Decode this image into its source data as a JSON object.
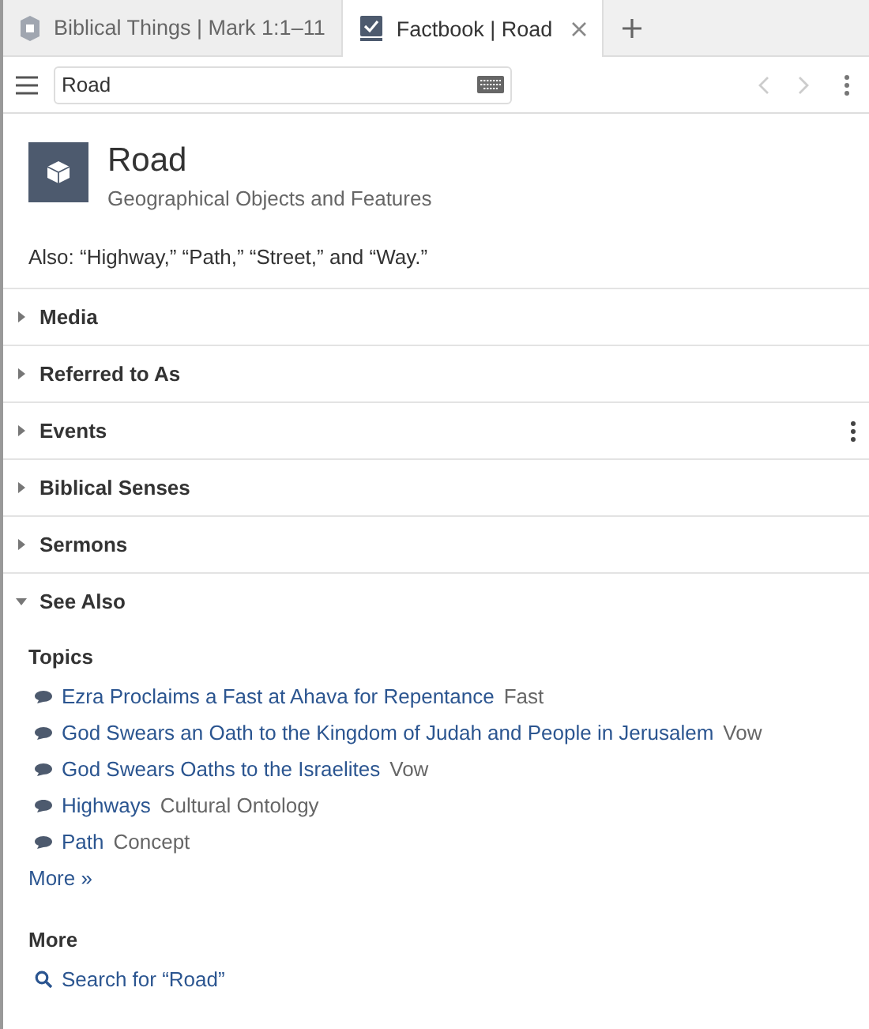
{
  "tabs": [
    {
      "label": "Biblical Things | Mark 1:1–11",
      "selected": false,
      "kind": "shield"
    },
    {
      "label": "Factbook | Road",
      "selected": true,
      "kind": "check"
    }
  ],
  "toolbar": {
    "search_value": "Road"
  },
  "header": {
    "title": "Road",
    "subtitle": "Geographical Objects and Features"
  },
  "also": "Also: “Highway,” “Path,” “Street,” and “Way.”",
  "sections": [
    {
      "label": "Media",
      "expanded": false,
      "hovered": false
    },
    {
      "label": "Referred to As",
      "expanded": false,
      "hovered": false
    },
    {
      "label": "Events",
      "expanded": false,
      "hovered": true
    },
    {
      "label": "Biblical Senses",
      "expanded": false,
      "hovered": false
    },
    {
      "label": "Sermons",
      "expanded": false,
      "hovered": false
    },
    {
      "label": "See Also",
      "expanded": true,
      "hovered": false
    }
  ],
  "see_also": {
    "topics_heading": "Topics",
    "topics": [
      {
        "title": "Ezra Proclaims a Fast at Ahava for Repentance",
        "type": "Fast"
      },
      {
        "title": "God Swears an Oath to the Kingdom of Judah and People in Jerusalem",
        "type": "Vow"
      },
      {
        "title": "God Swears Oaths to the Israelites",
        "type": "Vow"
      },
      {
        "title": "Highways",
        "type": "Cultural Ontology"
      },
      {
        "title": "Path",
        "type": "Concept"
      }
    ],
    "more_link": "More »",
    "more_heading": "More",
    "search_link": "Search for “Road”"
  }
}
